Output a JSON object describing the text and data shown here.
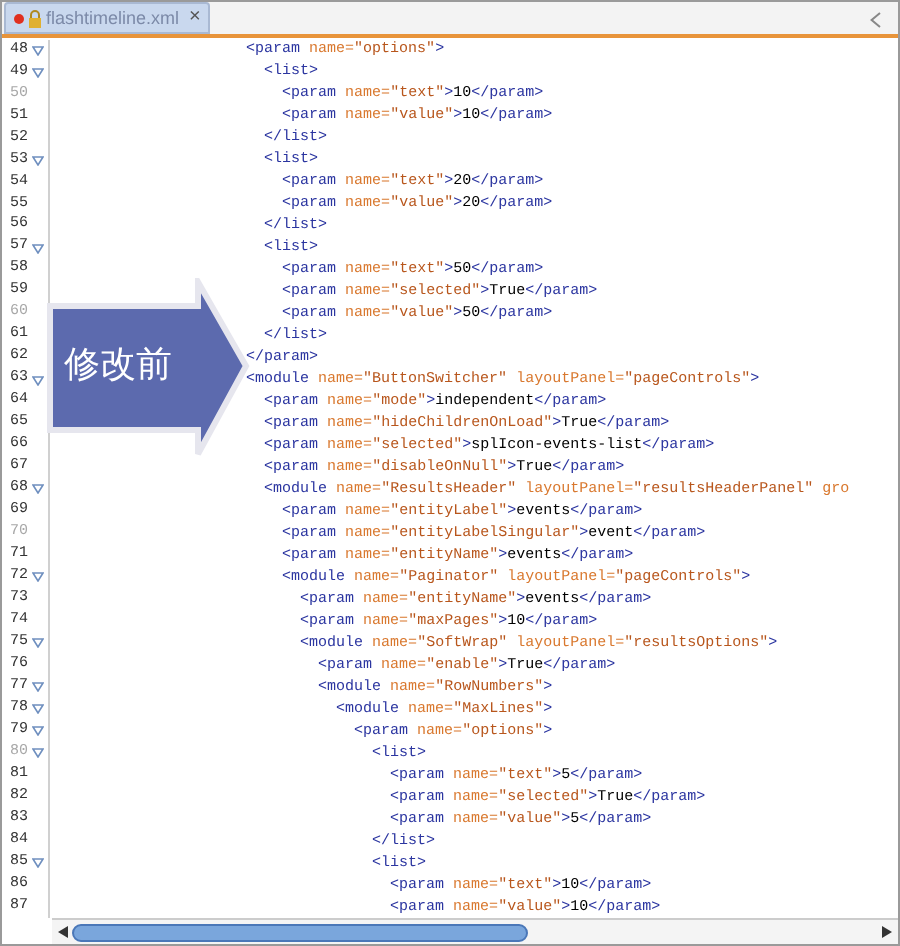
{
  "tab": {
    "title": "flashtimeline.xml",
    "modified": true,
    "locked": true,
    "close": "×"
  },
  "lines": [
    {
      "number": "48",
      "fold": true,
      "dim": false,
      "code": "<param name=\"options\">"
    },
    {
      "number": "49",
      "fold": true,
      "dim": false,
      "code": "  <list>"
    },
    {
      "number": "50",
      "fold": false,
      "dim": true,
      "code": "    <param name=\"text\">10</param>"
    },
    {
      "number": "51",
      "fold": false,
      "dim": false,
      "code": "    <param name=\"value\">10</param>"
    },
    {
      "number": "52",
      "fold": false,
      "dim": false,
      "code": "  </list>"
    },
    {
      "number": "53",
      "fold": true,
      "dim": false,
      "code": "  <list>"
    },
    {
      "number": "54",
      "fold": false,
      "dim": false,
      "code": "    <param name=\"text\">20</param>"
    },
    {
      "number": "55",
      "fold": false,
      "dim": false,
      "code": "    <param name=\"value\">20</param>"
    },
    {
      "number": "56",
      "fold": false,
      "dim": false,
      "code": "  </list>"
    },
    {
      "number": "57",
      "fold": true,
      "dim": false,
      "code": "  <list>"
    },
    {
      "number": "58",
      "fold": false,
      "dim": false,
      "code": "    <param name=\"text\">50</param>"
    },
    {
      "number": "59",
      "fold": false,
      "dim": false,
      "code": "    <param name=\"selected\">True</param>"
    },
    {
      "number": "60",
      "fold": false,
      "dim": true,
      "code": "    <param name=\"value\">50</param>"
    },
    {
      "number": "61",
      "fold": false,
      "dim": false,
      "code": "  </list>"
    },
    {
      "number": "62",
      "fold": false,
      "dim": false,
      "code": "</param>"
    },
    {
      "number": "63",
      "fold": true,
      "dim": false,
      "code": "<module name=\"ButtonSwitcher\" layoutPanel=\"pageControls\">"
    },
    {
      "number": "64",
      "fold": false,
      "dim": false,
      "code": "  <param name=\"mode\">independent</param>"
    },
    {
      "number": "65",
      "fold": false,
      "dim": false,
      "code": "  <param name=\"hideChildrenOnLoad\">True</param>"
    },
    {
      "number": "66",
      "fold": false,
      "dim": false,
      "code": "  <param name=\"selected\">splIcon-events-list</param>"
    },
    {
      "number": "67",
      "fold": false,
      "dim": false,
      "code": "  <param name=\"disableOnNull\">True</param>"
    },
    {
      "number": "68",
      "fold": true,
      "dim": false,
      "code": "  <module name=\"ResultsHeader\" layoutPanel=\"resultsHeaderPanel\" gro"
    },
    {
      "number": "69",
      "fold": false,
      "dim": false,
      "code": "    <param name=\"entityLabel\">events</param>"
    },
    {
      "number": "70",
      "fold": false,
      "dim": true,
      "code": "    <param name=\"entityLabelSingular\">event</param>"
    },
    {
      "number": "71",
      "fold": false,
      "dim": false,
      "code": "    <param name=\"entityName\">events</param>"
    },
    {
      "number": "72",
      "fold": true,
      "dim": false,
      "code": "    <module name=\"Paginator\" layoutPanel=\"pageControls\">"
    },
    {
      "number": "73",
      "fold": false,
      "dim": false,
      "code": "      <param name=\"entityName\">events</param>"
    },
    {
      "number": "74",
      "fold": false,
      "dim": false,
      "code": "      <param name=\"maxPages\">10</param>"
    },
    {
      "number": "75",
      "fold": true,
      "dim": false,
      "code": "      <module name=\"SoftWrap\" layoutPanel=\"resultsOptions\">"
    },
    {
      "number": "76",
      "fold": false,
      "dim": false,
      "code": "        <param name=\"enable\">True</param>"
    },
    {
      "number": "77",
      "fold": true,
      "dim": false,
      "code": "        <module name=\"RowNumbers\">"
    },
    {
      "number": "78",
      "fold": true,
      "dim": false,
      "code": "          <module name=\"MaxLines\">"
    },
    {
      "number": "79",
      "fold": true,
      "dim": false,
      "code": "            <param name=\"options\">"
    },
    {
      "number": "80",
      "fold": true,
      "dim": true,
      "code": "              <list>"
    },
    {
      "number": "81",
      "fold": false,
      "dim": false,
      "code": "                <param name=\"text\">5</param>"
    },
    {
      "number": "82",
      "fold": false,
      "dim": false,
      "code": "                <param name=\"selected\">True</param>"
    },
    {
      "number": "83",
      "fold": false,
      "dim": false,
      "code": "                <param name=\"value\">5</param>"
    },
    {
      "number": "84",
      "fold": false,
      "dim": false,
      "code": "              </list>"
    },
    {
      "number": "85",
      "fold": true,
      "dim": false,
      "code": "              <list>"
    },
    {
      "number": "86",
      "fold": false,
      "dim": false,
      "code": "                <param name=\"text\">10</param>"
    },
    {
      "number": "87",
      "fold": false,
      "dim": false,
      "code": "                <param name=\"value\">10</param>"
    }
  ],
  "callout": {
    "text": "修改前"
  }
}
